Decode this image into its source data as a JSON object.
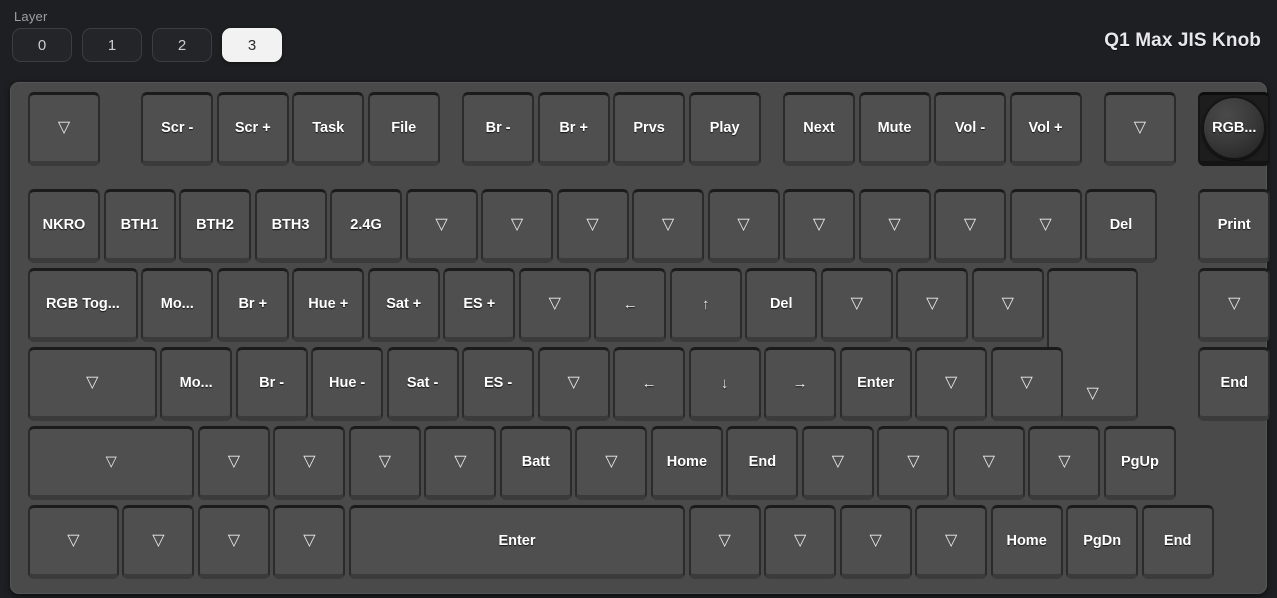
{
  "top_bar": {
    "layer_label": "Layer",
    "layers": [
      {
        "label": "0",
        "active": false
      },
      {
        "label": "1",
        "active": false
      },
      {
        "label": "2",
        "active": false
      },
      {
        "label": "3",
        "active": true
      }
    ],
    "keyboard_title": "Q1 Max JIS Knob"
  },
  "colors": {
    "page_background": "#1e1f22",
    "case": "#4a4a4a",
    "keycap": "#4f4f4f",
    "keycap_shadow": "#1b1b1b",
    "legend": "#ffffff",
    "layer_active_bg": "#f2f2f2",
    "layer_active_text": "#2b2b2b",
    "encoder": "#1d1d1d"
  },
  "keyboard": {
    "rows": [
      {
        "name": "row-function",
        "keys": [
          {
            "label": "▽",
            "kind": "blank",
            "x": 0,
            "w": 1
          },
          {
            "label": "Scr -",
            "kind": "text",
            "x": 1.5,
            "w": 1
          },
          {
            "label": "Scr +",
            "kind": "text",
            "x": 2.5,
            "w": 1
          },
          {
            "label": "Task",
            "kind": "text",
            "x": 3.5,
            "w": 1
          },
          {
            "label": "File",
            "kind": "text",
            "x": 4.5,
            "w": 1
          },
          {
            "label": "Br -",
            "kind": "text",
            "x": 5.75,
            "w": 1
          },
          {
            "label": "Br +",
            "kind": "text",
            "x": 6.75,
            "w": 1
          },
          {
            "label": "Prvs",
            "kind": "text",
            "x": 7.75,
            "w": 1
          },
          {
            "label": "Play",
            "kind": "text",
            "x": 8.75,
            "w": 1
          },
          {
            "label": "Next",
            "kind": "text",
            "x": 10,
            "w": 1
          },
          {
            "label": "Mute",
            "kind": "text",
            "x": 11,
            "w": 1
          },
          {
            "label": "Vol -",
            "kind": "text",
            "x": 12,
            "w": 1
          },
          {
            "label": "Vol +",
            "kind": "text",
            "x": 13,
            "w": 1
          },
          {
            "label": "▽",
            "kind": "blank",
            "x": 14.25,
            "w": 1
          },
          {
            "label": "RGB...",
            "kind": "encoder",
            "x": 15.5,
            "w": 1
          }
        ]
      },
      {
        "name": "row-number",
        "keys": [
          {
            "label": "NKRO",
            "kind": "text",
            "x": 0,
            "w": 1
          },
          {
            "label": "BTH1",
            "kind": "text",
            "x": 1,
            "w": 1
          },
          {
            "label": "BTH2",
            "kind": "text",
            "x": 2,
            "w": 1
          },
          {
            "label": "BTH3",
            "kind": "text",
            "x": 3,
            "w": 1
          },
          {
            "label": "2.4G",
            "kind": "text",
            "x": 4,
            "w": 1
          },
          {
            "label": "▽",
            "kind": "blank",
            "x": 5,
            "w": 1
          },
          {
            "label": "▽",
            "kind": "blank",
            "x": 6,
            "w": 1
          },
          {
            "label": "▽",
            "kind": "blank",
            "x": 7,
            "w": 1
          },
          {
            "label": "▽",
            "kind": "blank",
            "x": 8,
            "w": 1
          },
          {
            "label": "▽",
            "kind": "blank",
            "x": 9,
            "w": 1
          },
          {
            "label": "▽",
            "kind": "blank",
            "x": 10,
            "w": 1
          },
          {
            "label": "▽",
            "kind": "blank",
            "x": 11,
            "w": 1
          },
          {
            "label": "▽",
            "kind": "blank",
            "x": 12,
            "w": 1
          },
          {
            "label": "▽",
            "kind": "blank",
            "x": 13,
            "w": 1
          },
          {
            "label": "Del",
            "kind": "text",
            "x": 14,
            "w": 1
          },
          {
            "label": "Print",
            "kind": "text",
            "x": 15.5,
            "w": 1
          }
        ]
      },
      {
        "name": "row-top-alpha",
        "keys": [
          {
            "label": "RGB Tog...",
            "kind": "text",
            "x": 0,
            "w": 1.5
          },
          {
            "label": "Mo...",
            "kind": "text",
            "x": 1.5,
            "w": 1
          },
          {
            "label": "Br +",
            "kind": "text",
            "x": 2.5,
            "w": 1
          },
          {
            "label": "Hue +",
            "kind": "text",
            "x": 3.5,
            "w": 1
          },
          {
            "label": "Sat +",
            "kind": "text",
            "x": 4.5,
            "w": 1
          },
          {
            "label": "ES +",
            "kind": "text",
            "x": 5.5,
            "w": 1
          },
          {
            "label": "▽",
            "kind": "blank",
            "x": 6.5,
            "w": 1
          },
          {
            "label": "←",
            "kind": "arrow",
            "x": 7.5,
            "w": 1
          },
          {
            "label": "↑",
            "kind": "arrow",
            "x": 8.5,
            "w": 1
          },
          {
            "label": "Del",
            "kind": "text",
            "x": 9.5,
            "w": 1
          },
          {
            "label": "▽",
            "kind": "blank",
            "x": 10.5,
            "w": 1
          },
          {
            "label": "▽",
            "kind": "blank",
            "x": 11.5,
            "w": 1
          },
          {
            "label": "▽",
            "kind": "blank",
            "x": 12.5,
            "w": 1
          },
          {
            "label": "▽",
            "kind": "blank",
            "x": 13.5,
            "w": 1.25,
            "tall": true
          },
          {
            "label": "▽",
            "kind": "blank",
            "x": 15.5,
            "w": 1
          }
        ]
      },
      {
        "name": "row-home",
        "keys": [
          {
            "label": "▽",
            "kind": "blank",
            "x": 0,
            "w": 1.75
          },
          {
            "label": "Mo...",
            "kind": "text",
            "x": 1.75,
            "w": 1
          },
          {
            "label": "Br -",
            "kind": "text",
            "x": 2.75,
            "w": 1
          },
          {
            "label": "Hue -",
            "kind": "text",
            "x": 3.75,
            "w": 1
          },
          {
            "label": "Sat -",
            "kind": "text",
            "x": 4.75,
            "w": 1
          },
          {
            "label": "ES -",
            "kind": "text",
            "x": 5.75,
            "w": 1
          },
          {
            "label": "▽",
            "kind": "blank",
            "x": 6.75,
            "w": 1
          },
          {
            "label": "←",
            "kind": "arrow",
            "x": 7.75,
            "w": 1
          },
          {
            "label": "↓",
            "kind": "arrow",
            "x": 8.75,
            "w": 1
          },
          {
            "label": "→",
            "kind": "arrow",
            "x": 9.75,
            "w": 1
          },
          {
            "label": "Enter",
            "kind": "text",
            "x": 10.75,
            "w": 1
          },
          {
            "label": "▽",
            "kind": "blank",
            "x": 11.75,
            "w": 1
          },
          {
            "label": "▽",
            "kind": "blank",
            "x": 12.75,
            "w": 1
          },
          {
            "label": "End",
            "kind": "text",
            "x": 15.5,
            "w": 1
          }
        ]
      },
      {
        "name": "row-shift",
        "keys": [
          {
            "label": "▽",
            "kind": "blank",
            "x": 0,
            "w": 2.25
          },
          {
            "label": "▽",
            "kind": "blank",
            "x": 2.25,
            "w": 1
          },
          {
            "label": "▽",
            "kind": "blank",
            "x": 3.25,
            "w": 1
          },
          {
            "label": "▽",
            "kind": "blank",
            "x": 4.25,
            "w": 1
          },
          {
            "label": "▽",
            "kind": "blank",
            "x": 5.25,
            "w": 1
          },
          {
            "label": "Batt",
            "kind": "text",
            "x": 6.25,
            "w": 1
          },
          {
            "label": "▽",
            "kind": "blank",
            "x": 7.25,
            "w": 1
          },
          {
            "label": "Home",
            "kind": "text",
            "x": 8.25,
            "w": 1
          },
          {
            "label": "End",
            "kind": "text",
            "x": 9.25,
            "w": 1
          },
          {
            "label": "▽",
            "kind": "blank",
            "x": 10.25,
            "w": 1
          },
          {
            "label": "▽",
            "kind": "blank",
            "x": 11.25,
            "w": 1
          },
          {
            "label": "▽",
            "kind": "blank",
            "x": 12.25,
            "w": 1
          },
          {
            "label": "▽",
            "kind": "blank",
            "x": 13.25,
            "w": 1
          },
          {
            "label": "PgUp",
            "kind": "text",
            "x": 14.25,
            "w": 1
          }
        ]
      },
      {
        "name": "row-bottom",
        "keys": [
          {
            "label": "▽",
            "kind": "blank",
            "x": 0,
            "w": 1.25
          },
          {
            "label": "▽",
            "kind": "blank",
            "x": 1.25,
            "w": 1
          },
          {
            "label": "▽",
            "kind": "blank",
            "x": 2.25,
            "w": 1
          },
          {
            "label": "▽",
            "kind": "blank",
            "x": 3.25,
            "w": 1
          },
          {
            "label": "Enter",
            "kind": "text",
            "x": 4.25,
            "w": 4.5
          },
          {
            "label": "▽",
            "kind": "blank",
            "x": 8.75,
            "w": 1
          },
          {
            "label": "▽",
            "kind": "blank",
            "x": 9.75,
            "w": 1
          },
          {
            "label": "▽",
            "kind": "blank",
            "x": 10.75,
            "w": 1
          },
          {
            "label": "▽",
            "kind": "blank",
            "x": 11.75,
            "w": 1
          },
          {
            "label": "Home",
            "kind": "text",
            "x": 12.75,
            "w": 1
          },
          {
            "label": "PgDn",
            "kind": "text",
            "x": 13.75,
            "w": 1
          },
          {
            "label": "End",
            "kind": "text",
            "x": 14.75,
            "w": 1
          }
        ]
      }
    ]
  }
}
